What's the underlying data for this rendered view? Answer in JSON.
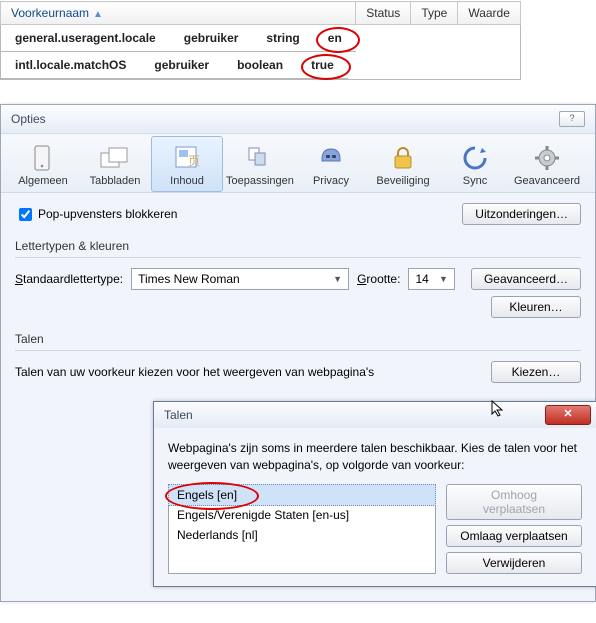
{
  "config_table": {
    "headers": {
      "name": "Voorkeurnaam",
      "status": "Status",
      "type": "Type",
      "value": "Waarde"
    },
    "rows": [
      {
        "name": "general.useragent.locale",
        "status": "gebruiker",
        "type": "string",
        "value": "en"
      },
      {
        "name": "intl.locale.matchOS",
        "status": "gebruiker",
        "type": "boolean",
        "value": "true"
      }
    ]
  },
  "options_window": {
    "title": "Opties",
    "toolbar": {
      "items": [
        {
          "label": "Algemeen"
        },
        {
          "label": "Tabbladen"
        },
        {
          "label": "Inhoud"
        },
        {
          "label": "Toepassingen"
        },
        {
          "label": "Privacy"
        },
        {
          "label": "Beveiliging"
        },
        {
          "label": "Sync"
        },
        {
          "label": "Geavanceerd"
        }
      ]
    },
    "popup_section": {
      "checkbox_label": "Pop-upvensters blokkeren",
      "exceptions_btn": "Uitzonderingen…"
    },
    "fonts_section": {
      "heading": "Lettertypen & kleuren",
      "default_font_label": "Standaardlettertype:",
      "default_font_value": "Times New Roman",
      "size_label": "Grootte:",
      "size_value": "14",
      "advanced_btn": "Geavanceerd…",
      "colors_btn": "Kleuren…"
    },
    "langs_section": {
      "heading": "Talen",
      "description": "Talen van uw voorkeur kiezen voor het weergeven van webpagina's",
      "choose_btn": "Kiezen…"
    }
  },
  "talen_dialog": {
    "title": "Talen",
    "intro": "Webpagina's zijn soms in meerdere talen beschikbaar. Kies de talen voor het weergeven van webpagina's, op volgorde van voorkeur:",
    "items": [
      "Engels  [en]",
      "Engels/Verenigde Staten  [en-us]",
      "Nederlands  [nl]"
    ],
    "buttons": {
      "up": "Omhoog verplaatsen",
      "down": "Omlaag verplaatsen",
      "remove": "Verwijderen"
    }
  }
}
